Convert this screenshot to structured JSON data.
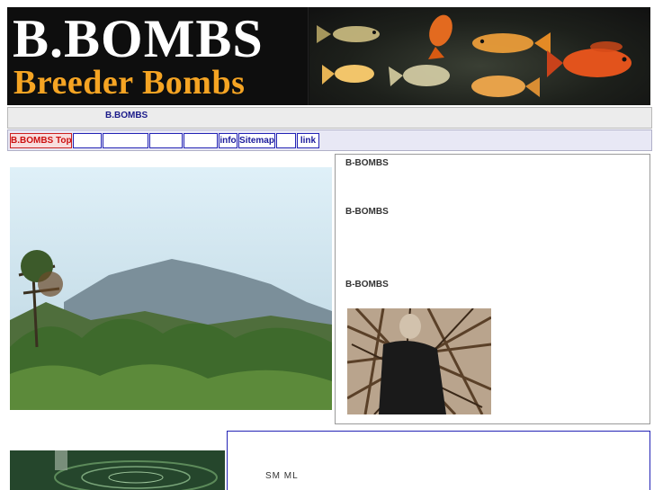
{
  "banner": {
    "logo_top": "B.BOMBS",
    "logo_bottom": "Breeder Bombs",
    "accent_color": "#f5a423"
  },
  "title_bar": {
    "title": "B.BOMBS"
  },
  "nav": {
    "items": [
      {
        "label": "B.BOMBS Top",
        "active": true
      },
      {
        "label": ""
      },
      {
        "label": ""
      },
      {
        "label": ""
      },
      {
        "label": ""
      },
      {
        "label": "info"
      },
      {
        "label": "Sitemap"
      },
      {
        "label": ""
      },
      {
        "label": "link"
      }
    ]
  },
  "right_panel": {
    "label_1": "B-BOMBS",
    "label_2": "B-BOMBS",
    "label_3": "B-BOMBS"
  },
  "bottom_panel": {
    "sizes": "SM  ML"
  },
  "colors": {
    "nav_border": "#2323b5",
    "nav_text": "#1b1b9b",
    "active_nav": "#cc1010",
    "title_text": "#1c1c8a"
  }
}
